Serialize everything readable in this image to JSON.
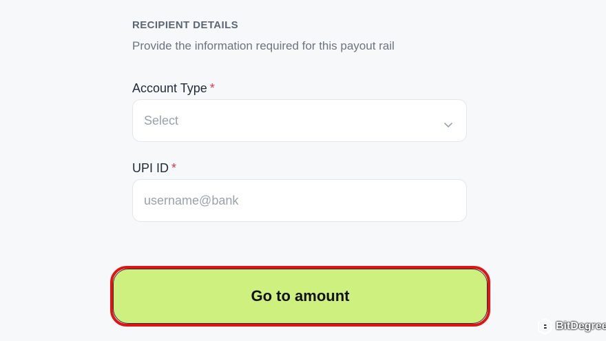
{
  "section": {
    "title": "RECIPIENT DETAILS",
    "subtitle": "Provide the information required for this payout rail"
  },
  "fields": {
    "account_type": {
      "label": "Account Type",
      "required_mark": "*",
      "placeholder": "Select",
      "icon": "chevron-down-icon"
    },
    "upi_id": {
      "label": "UPI ID",
      "required_mark": "*",
      "placeholder": "username@bank"
    }
  },
  "actions": {
    "primary_label": "Go to amount"
  },
  "watermark": {
    "text": "BitDegree",
    "icon": "bitdegree-logo-icon"
  },
  "colors": {
    "background": "#f7f8fa",
    "primary_button": "#cef07f",
    "highlight_border": "#e01414",
    "required": "#e5383b"
  }
}
